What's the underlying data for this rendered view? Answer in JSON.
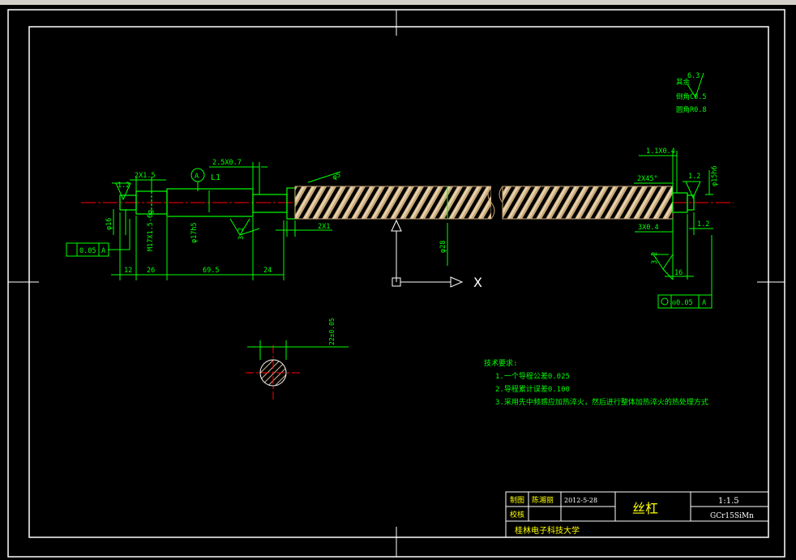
{
  "colors": {
    "background": "#000000",
    "border": "#ffffff",
    "dim": "#00ff00",
    "thread": "#d2b48c",
    "centerline": "#ff0000",
    "note": "#ffff00"
  },
  "surface_finish": {
    "line1": "其余",
    "value": "6.3",
    "line2": "倒角C0.5",
    "line3": "圆角R0.8"
  },
  "dims": {
    "d_2x15": "2X1.5",
    "d_25x07": "2.5X0.7",
    "d_l1": "L1",
    "d_12": "12",
    "d_26": "26",
    "d_695": "69.5",
    "d_24": "24",
    "d_m17": "M17X1.5-6g",
    "d_phi17": "φ17h5",
    "d_phi16": "φ16",
    "d_32a": "3.2",
    "d_2x1": "2X1",
    "d_phi5": "φ5",
    "d_phi28": "φ28",
    "d_11x04": "1.1X0.4",
    "d_2x45": "2X45°",
    "d_3x04": "3X0.4",
    "d_12b": "1.2",
    "d_12c": "1.2",
    "d_12d": "1.2",
    "d_16": "16",
    "d_32b": "3.2",
    "d_phi15": "φ15h6",
    "d_tol1": "0.05",
    "d_tolA1": "A",
    "d_tol2": "◎0.05",
    "d_tolA2": "A",
    "d_section": "22±0.05",
    "d_arrowA": "A",
    "axis_x": "X"
  },
  "notes": {
    "title": "技术要求:",
    "items": [
      "1.一个导程公差0.025",
      "2.导程累计误差0.100",
      "3.采用先中频感应加热淬火，然后进行整体加热淬火的热处理方式"
    ]
  },
  "title_block": {
    "r1c1": "制图",
    "r1c2": "陈湘丽",
    "r1c3": "2012-5-28",
    "r2c1": "校核",
    "name": "丝杠",
    "scale": "1:1.5",
    "material": "GCr15SiMn",
    "school": "桂林电子科技大学"
  }
}
